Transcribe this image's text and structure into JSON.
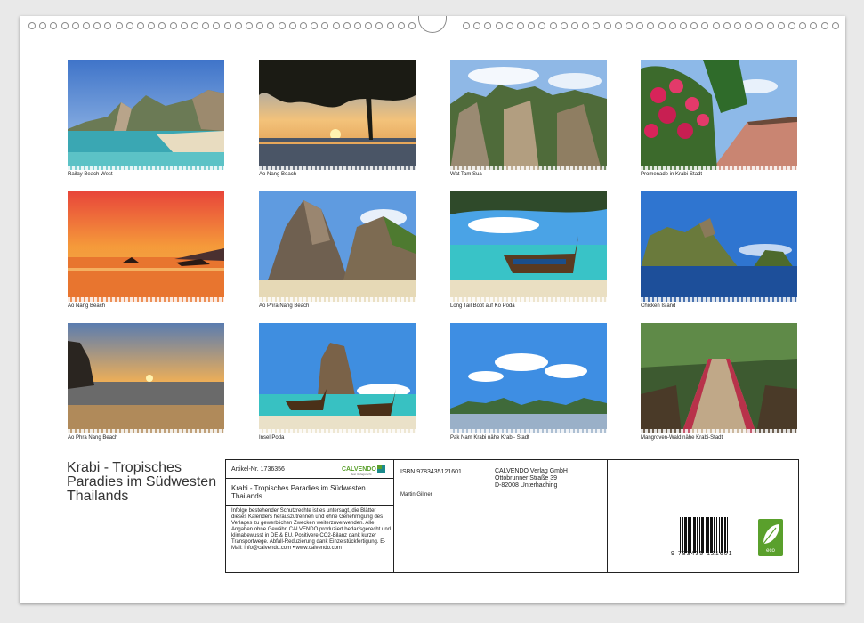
{
  "photos": [
    {
      "caption": "Railay Beach West",
      "scene": "beach-cliffs"
    },
    {
      "caption": "Ao Nang Beach",
      "scene": "sunset-tree"
    },
    {
      "caption": "Wat Tam Sua",
      "scene": "karst-mountains"
    },
    {
      "caption": "Promenade in Krabi-Stadt",
      "scene": "promenade-flowers"
    },
    {
      "caption": "Ao Nang Beach",
      "scene": "orange-sunset-boats"
    },
    {
      "caption": "Ao Phra Nang Beach",
      "scene": "karst-rock-beach"
    },
    {
      "caption": "Long Tail Boot auf Ko Poda",
      "scene": "longtail-boat"
    },
    {
      "caption": "Chicken Island",
      "scene": "island-sea"
    },
    {
      "caption": "Ao Phra Nang Beach",
      "scene": "sunset-cliff"
    },
    {
      "caption": "Insel Poda",
      "scene": "rock-boats"
    },
    {
      "caption": "Pak Nam Krabi nähe Krabi- Stadt",
      "scene": "sky-islands"
    },
    {
      "caption": "Mangroven-Wald nähe Krabi-Stadt",
      "scene": "mangrove-walkway"
    }
  ],
  "title": "Krabi - Tropisches Paradies im Südwesten Thailands",
  "info": {
    "article": "Artikel-Nr. 1736356",
    "logo_text": "CALVENDO",
    "logo_sub": "Best Verlagsrecht",
    "subtitle": "Krabi - Tropisches Paradies im Südwesten Thailands",
    "legal": "Infolge bestehender Schutzrechte ist es untersagt, die Blätter dieses Kalenders herauszutrennen und ohne Genehmigung des Verlages zu gewerblichen Zwecken weiterzuverwenden. Alle Angaben ohne Gewähr. CALVENDO produziert bedarfsgerecht und klimabewusst in DE & EU. Positivere CO2-Bilanz dank kurzer Transportwege. Abfall-Reduzierung dank Einzelstückfertigung. E-Mail: info@calvendo.com • www.calvendo.com",
    "isbn": "ISBN 9783435121601",
    "author": "Martin Gillner",
    "publisher": "CALVENDO Verlag GmbH",
    "street": "Ottobrunner Straße 39",
    "city": "D-82008 Unterhaching",
    "barcode_digits": "9   783435   121601",
    "eco_label": "eco"
  },
  "colors": {
    "logo_green": "#5aa02c",
    "logo_teal": "#1b8a8c",
    "text": "#222222"
  }
}
